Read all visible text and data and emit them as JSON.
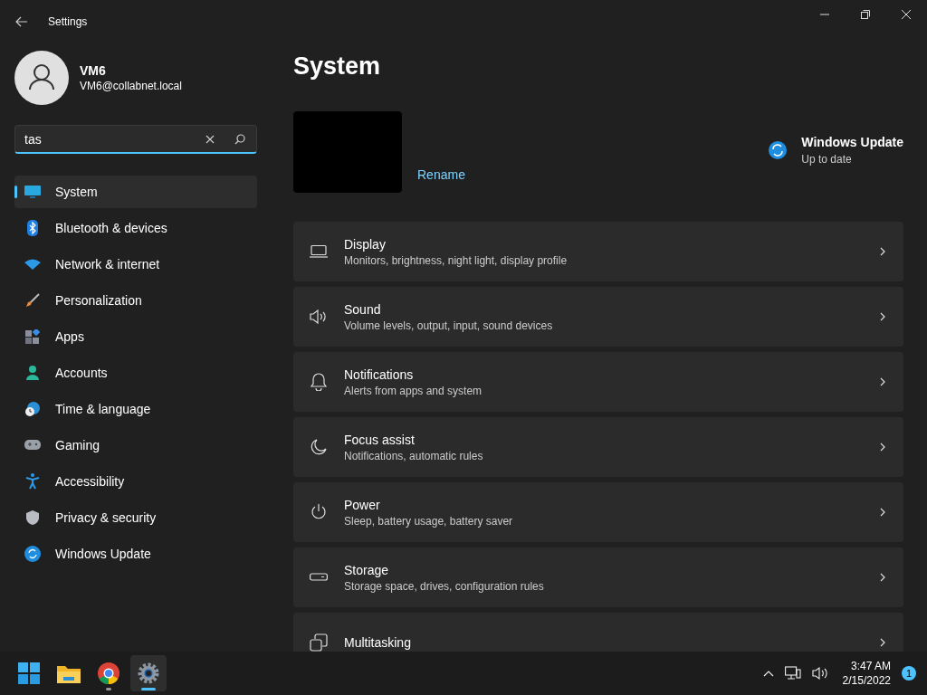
{
  "window": {
    "title": "Settings"
  },
  "user": {
    "name": "VM6",
    "email": "VM6@collabnet.local"
  },
  "search": {
    "value": "tas"
  },
  "sidebar": {
    "items": [
      {
        "label": "System",
        "kind": "system",
        "selected": true
      },
      {
        "label": "Bluetooth & devices",
        "kind": "bluetooth",
        "selected": false
      },
      {
        "label": "Network & internet",
        "kind": "network",
        "selected": false
      },
      {
        "label": "Personalization",
        "kind": "brush",
        "selected": false
      },
      {
        "label": "Apps",
        "kind": "apps",
        "selected": false
      },
      {
        "label": "Accounts",
        "kind": "accounts",
        "selected": false
      },
      {
        "label": "Time & language",
        "kind": "time",
        "selected": false
      },
      {
        "label": "Gaming",
        "kind": "gaming",
        "selected": false
      },
      {
        "label": "Accessibility",
        "kind": "accessibility",
        "selected": false
      },
      {
        "label": "Privacy & security",
        "kind": "privacy",
        "selected": false
      },
      {
        "label": "Windows Update",
        "kind": "update",
        "selected": false
      }
    ]
  },
  "page": {
    "title": "System",
    "rename": "Rename",
    "update": {
      "title": "Windows Update",
      "status": "Up to date"
    },
    "cards": [
      {
        "title": "Display",
        "subtitle": "Monitors, brightness, night light, display profile",
        "kind": "display"
      },
      {
        "title": "Sound",
        "subtitle": "Volume levels, output, input, sound devices",
        "kind": "sound"
      },
      {
        "title": "Notifications",
        "subtitle": "Alerts from apps and system",
        "kind": "bell"
      },
      {
        "title": "Focus assist",
        "subtitle": "Notifications, automatic rules",
        "kind": "moon"
      },
      {
        "title": "Power",
        "subtitle": "Sleep, battery usage, battery saver",
        "kind": "power"
      },
      {
        "title": "Storage",
        "subtitle": "Storage space, drives, configuration rules",
        "kind": "storage"
      },
      {
        "title": "Multitasking",
        "kind": "multitasking"
      }
    ]
  },
  "taskbar": {
    "apps": [
      {
        "kind": "start",
        "running": false,
        "selected": false
      },
      {
        "kind": "folder",
        "running": false,
        "selected": false
      },
      {
        "kind": "browser",
        "running": true,
        "selected": false
      },
      {
        "kind": "settings",
        "running": true,
        "selected": true
      }
    ],
    "time": "3:47 AM",
    "date": "2/15/2022",
    "notifications": "1"
  }
}
